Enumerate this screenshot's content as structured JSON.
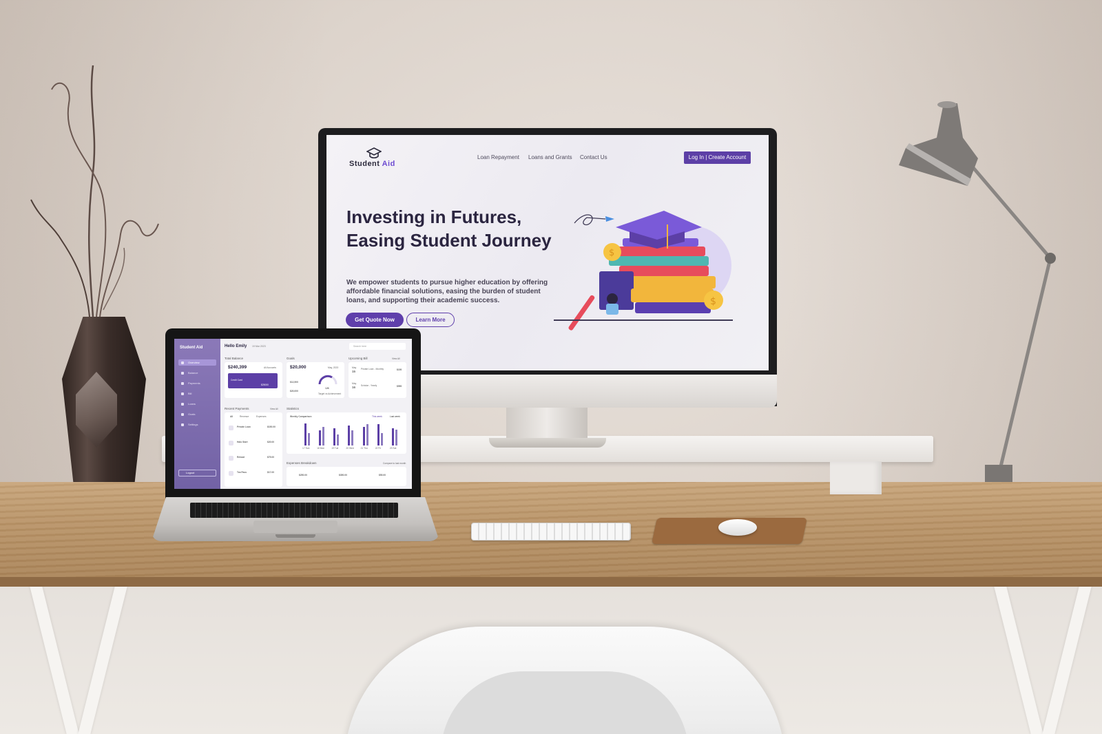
{
  "imac": {
    "site": {
      "logo_word1": "Student",
      "logo_word2": "Aid",
      "nav": [
        "Loan Repayment",
        "Loans and Grants",
        "Contact Us"
      ],
      "auth_button": "Log In  |  Create Account",
      "hero_title": "Investing in Futures, Easing Student Journey",
      "hero_subtitle": "We empower students to pursue higher education by offering affordable financial solutions, easing the burden of student loans, and supporting their academic success.",
      "cta_primary": "Get Quote Now",
      "cta_secondary": "Learn More"
    }
  },
  "laptop": {
    "dashboard": {
      "brand": "Student Aid",
      "sidebar": [
        "Overview",
        "Balance",
        "Payments",
        "Bill",
        "Loans",
        "Goals",
        "Settings"
      ],
      "logout": "Logout",
      "greeting": "Hello Emily",
      "date": "19 Mar 2023",
      "search_placeholder": "Search here",
      "total_balance": {
        "title": "Total Balance",
        "amount": "$240,399",
        "accounts": "All Accounts",
        "card_type": "Credit Card",
        "card_amount": "$25000"
      },
      "goals": {
        "title": "Goals",
        "amount": "$20,000",
        "month": "May, 2023",
        "target_achieved": "$12,500",
        "this_month_target": "$20,000",
        "gauge_value": "12K",
        "gauge_label": "Target vs Achievement"
      },
      "upcoming": {
        "title": "Upcoming Bill",
        "view_all": "View All",
        "items": [
          {
            "month": "May",
            "day": "15",
            "name": "Private Loan - Monthly",
            "amount": "$150"
          },
          {
            "month": "May",
            "day": "16",
            "name": "Scholar - Yearly",
            "amount": "$550"
          }
        ]
      },
      "recent": {
        "title": "Recent Payments",
        "view_all": "View All",
        "tabs": [
          "All",
          "Revenue",
          "Expenses"
        ],
        "items": [
          {
            "name": "Private Loan",
            "amount": "$150.00"
          },
          {
            "name": "Halo Start",
            "amount": "$20.00"
          },
          {
            "name": "Reload",
            "amount": "$75.00"
          },
          {
            "name": "Tea Pass",
            "amount": "$17.00"
          }
        ]
      },
      "statistics": {
        "title": "Statistics",
        "selector": "Weekly Comparison",
        "legend": [
          "This week",
          "Last week"
        ],
        "days": [
          "17 Sun",
          "18 Mon",
          "19 Tue",
          "20 Wed",
          "21 Thu",
          "22 Fri",
          "23 Sat"
        ]
      },
      "breakdown": {
        "title": "Expenses Breakdown",
        "compare": "Compare to last month",
        "items": [
          {
            "amount": "$250.00"
          },
          {
            "amount": "$350.00"
          },
          {
            "amount": "$50.00"
          }
        ]
      }
    }
  },
  "chart_data": {
    "type": "bar",
    "categories": [
      "17 Sun",
      "18 Mon",
      "19 Tue",
      "20 Wed",
      "21 Thu",
      "22 Fri",
      "23 Sat"
    ],
    "series": [
      {
        "name": "This week",
        "values": [
          18,
          12,
          14,
          16,
          15,
          17,
          14
        ]
      },
      {
        "name": "Last week",
        "values": [
          10,
          15,
          9,
          12,
          17,
          10,
          13
        ]
      }
    ]
  }
}
